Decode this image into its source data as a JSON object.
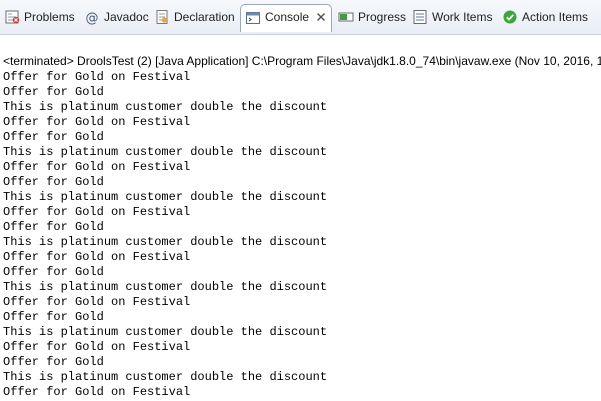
{
  "tabs": [
    {
      "label": "Problems",
      "icon": "problems-icon",
      "active": false
    },
    {
      "label": "Javadoc",
      "icon": "at-sign-icon",
      "active": false
    },
    {
      "label": "Declaration",
      "icon": "declaration-icon",
      "active": false
    },
    {
      "label": "Console",
      "icon": "console-icon",
      "active": true
    },
    {
      "label": "Progress",
      "icon": "progress-icon",
      "active": false
    },
    {
      "label": "Work Items",
      "icon": "work-items-icon",
      "active": false
    },
    {
      "label": "Action Items",
      "icon": "check-circle-icon",
      "active": false
    }
  ],
  "console": {
    "status": "<terminated> DroolsTest (2) [Java Application] C:\\Program Files\\Java\\jdk1.8.0_74\\bin\\javaw.exe (Nov 10, 2016, 12:0",
    "lines": [
      "Offer for Gold on Festival",
      "Offer for Gold",
      "This is platinum customer double the discount",
      "Offer for Gold on Festival",
      "Offer for Gold",
      "This is platinum customer double the discount",
      "Offer for Gold on Festival",
      "Offer for Gold",
      "This is platinum customer double the discount",
      "Offer for Gold on Festival",
      "Offer for Gold",
      "This is platinum customer double the discount",
      "Offer for Gold on Festival",
      "Offer for Gold",
      "This is platinum customer double the discount",
      "Offer for Gold on Festival",
      "Offer for Gold",
      "This is platinum customer double the discount",
      "Offer for Gold on Festival",
      "Offer for Gold",
      "This is platinum customer double the discount",
      "Offer for Gold on Festival"
    ]
  }
}
